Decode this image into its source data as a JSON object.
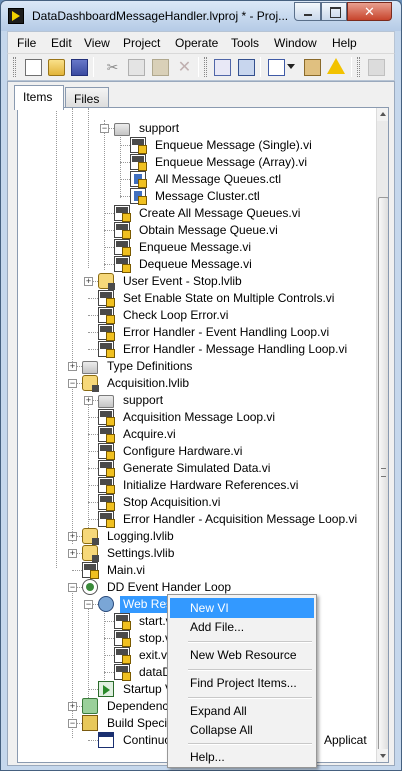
{
  "window": {
    "title": "DataDashboardMessageHandler.lvproj * - Proj...",
    "close_glyph": "✕"
  },
  "menu": [
    "File",
    "Edit",
    "View",
    "Project",
    "Operate",
    "Tools",
    "Window",
    "Help"
  ],
  "tabs": {
    "items": "Items",
    "files": "Files"
  },
  "tree": {
    "nodes": [
      {
        "label": "support",
        "icon": "folder",
        "expander": "minus"
      },
      {
        "label": "Enqueue Message (Single).vi",
        "icon": "vi"
      },
      {
        "label": "Enqueue Message (Array).vi",
        "icon": "vi"
      },
      {
        "label": "All Message Queues.ctl",
        "icon": "ctl"
      },
      {
        "label": "Message Cluster.ctl",
        "icon": "ctl"
      },
      {
        "label": "Create All Message Queues.vi",
        "icon": "vi"
      },
      {
        "label": "Obtain Message Queue.vi",
        "icon": "vi"
      },
      {
        "label": "Enqueue Message.vi",
        "icon": "vi"
      },
      {
        "label": "Dequeue Message.vi",
        "icon": "vi"
      },
      {
        "label": "User Event - Stop.lvlib",
        "icon": "lvlib",
        "expander": "plus"
      },
      {
        "label": "Set Enable State on Multiple Controls.vi",
        "icon": "vi"
      },
      {
        "label": "Check Loop Error.vi",
        "icon": "vi"
      },
      {
        "label": "Error Handler - Event Handling Loop.vi",
        "icon": "vi"
      },
      {
        "label": "Error Handler - Message Handling Loop.vi",
        "icon": "vi"
      },
      {
        "label": "Type Definitions",
        "icon": "folder",
        "expander": "plus"
      },
      {
        "label": "Acquisition.lvlib",
        "icon": "lvlib",
        "expander": "minus"
      },
      {
        "label": "support",
        "icon": "folder",
        "expander": "plus"
      },
      {
        "label": "Acquisition Message Loop.vi",
        "icon": "vi"
      },
      {
        "label": "Acquire.vi",
        "icon": "vi"
      },
      {
        "label": "Configure Hardware.vi",
        "icon": "vi"
      },
      {
        "label": "Generate Simulated Data.vi",
        "icon": "vi"
      },
      {
        "label": "Initialize Hardware References.vi",
        "icon": "vi"
      },
      {
        "label": "Stop Acquisition.vi",
        "icon": "vi"
      },
      {
        "label": "Error Handler - Acquisition Message Loop.vi",
        "icon": "vi"
      },
      {
        "label": "Logging.lvlib",
        "icon": "lvlib",
        "expander": "plus"
      },
      {
        "label": "Settings.lvlib",
        "icon": "lvlib",
        "expander": "plus"
      },
      {
        "label": "Main.vi",
        "icon": "vi"
      },
      {
        "label": "DD Event Hander Loop",
        "icon": "loop",
        "expander": "minus"
      },
      {
        "label": "Web Resou",
        "icon": "web",
        "expander": "minus",
        "selected": true
      },
      {
        "label": "start.vi",
        "icon": "vi"
      },
      {
        "label": "stop.vi",
        "icon": "vi"
      },
      {
        "label": "exit.vi (",
        "icon": "vi"
      },
      {
        "label": "dataDis",
        "icon": "vi"
      },
      {
        "label": "Startup VIs",
        "icon": "startup"
      },
      {
        "label": "Dependencie",
        "icon": "deps",
        "expander": "plus"
      },
      {
        "label": "Build Specific",
        "icon": "build",
        "expander": "minus"
      },
      {
        "label": "Continuou",
        "trailing": "Applicat",
        "icon": "exe"
      }
    ]
  },
  "context_menu": {
    "items": [
      "New VI",
      "Add File...",
      "New Web Resource",
      "Find Project Items...",
      "Expand All",
      "Collapse All",
      "Help..."
    ]
  }
}
